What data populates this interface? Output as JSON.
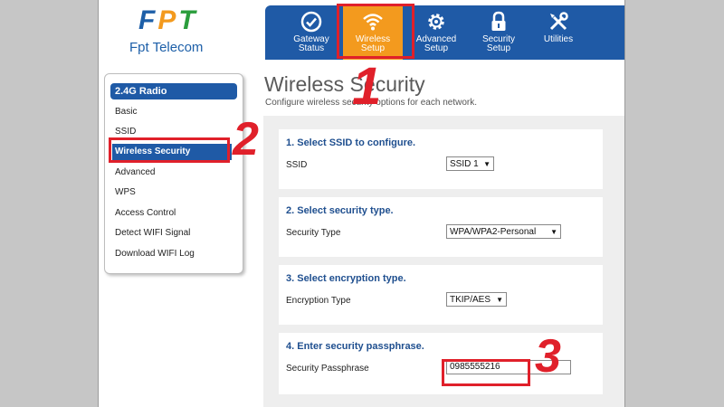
{
  "logo": {
    "letters": [
      "F",
      "P",
      "T"
    ],
    "letter_colors": [
      "#1d5fa8",
      "#f39a1e",
      "#2a9d3c"
    ],
    "brand": "Fpt Telecom"
  },
  "nav": {
    "items": [
      {
        "label1": "Gateway",
        "label2": "Status",
        "icon": "gauge-icon"
      },
      {
        "label1": "Wireless",
        "label2": "Setup",
        "icon": "wifi-icon",
        "active": true
      },
      {
        "label1": "Advanced",
        "label2": "Setup",
        "icon": "gear-icon"
      },
      {
        "label1": "Security",
        "label2": "Setup",
        "icon": "lock-icon"
      },
      {
        "label1": "Utilities",
        "label2": "",
        "icon": "tools-icon"
      }
    ],
    "accent": "#f39a1e",
    "bar_color": "#1f5aa6"
  },
  "sidebar": {
    "heading": "2.4G Radio",
    "items": [
      "Basic",
      "SSID",
      "Wireless Security",
      "Advanced",
      "WPS",
      "Access Control",
      "Detect WIFI Signal",
      "Download WIFI Log"
    ],
    "active_item": "Wireless Security"
  },
  "main": {
    "title": "Wireless Security",
    "subtitle": "Configure wireless security options for each network.",
    "sections": [
      {
        "title": "1. Select SSID to configure.",
        "label": "SSID",
        "value": "SSID 1"
      },
      {
        "title": "2. Select security type.",
        "label": "Security Type",
        "value": "WPA/WPA2-Personal"
      },
      {
        "title": "3. Select encryption type.",
        "label": "Encryption Type",
        "value": "TKIP/AES"
      },
      {
        "title": "4. Enter security passphrase.",
        "label": "Security Passphrase",
        "value": "0985555216"
      }
    ]
  },
  "annotations": {
    "numbers": [
      "1",
      "2",
      "3"
    ],
    "color": "#e0202a"
  }
}
